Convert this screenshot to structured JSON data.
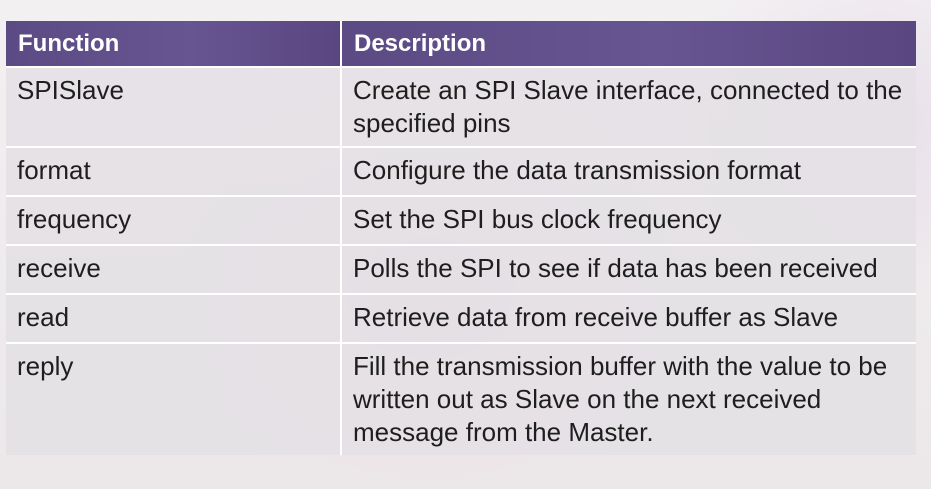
{
  "table": {
    "headers": [
      "Function",
      "Description"
    ],
    "rows": [
      {
        "function": "SPISlave",
        "description": "Create an SPI Slave interface, connected to the specified pins"
      },
      {
        "function": "format",
        "description": "Configure the data transmission format"
      },
      {
        "function": "frequency",
        "description": "Set the SPI bus clock frequency"
      },
      {
        "function": "receive",
        "description": "Polls the SPI to see if data has been received"
      },
      {
        "function": "read",
        "description": "Retrieve data from receive buffer as Slave"
      },
      {
        "function": "reply",
        "description": "Fill the transmission buffer with the value to be written out as Slave on the next received message from the Master."
      }
    ]
  },
  "colors": {
    "header_bg": "#5f4d88",
    "header_text": "#ffffff",
    "cell_bg": "#e4e0e5",
    "cell_text": "#1e1e1e",
    "grid_line": "#ffffff"
  }
}
